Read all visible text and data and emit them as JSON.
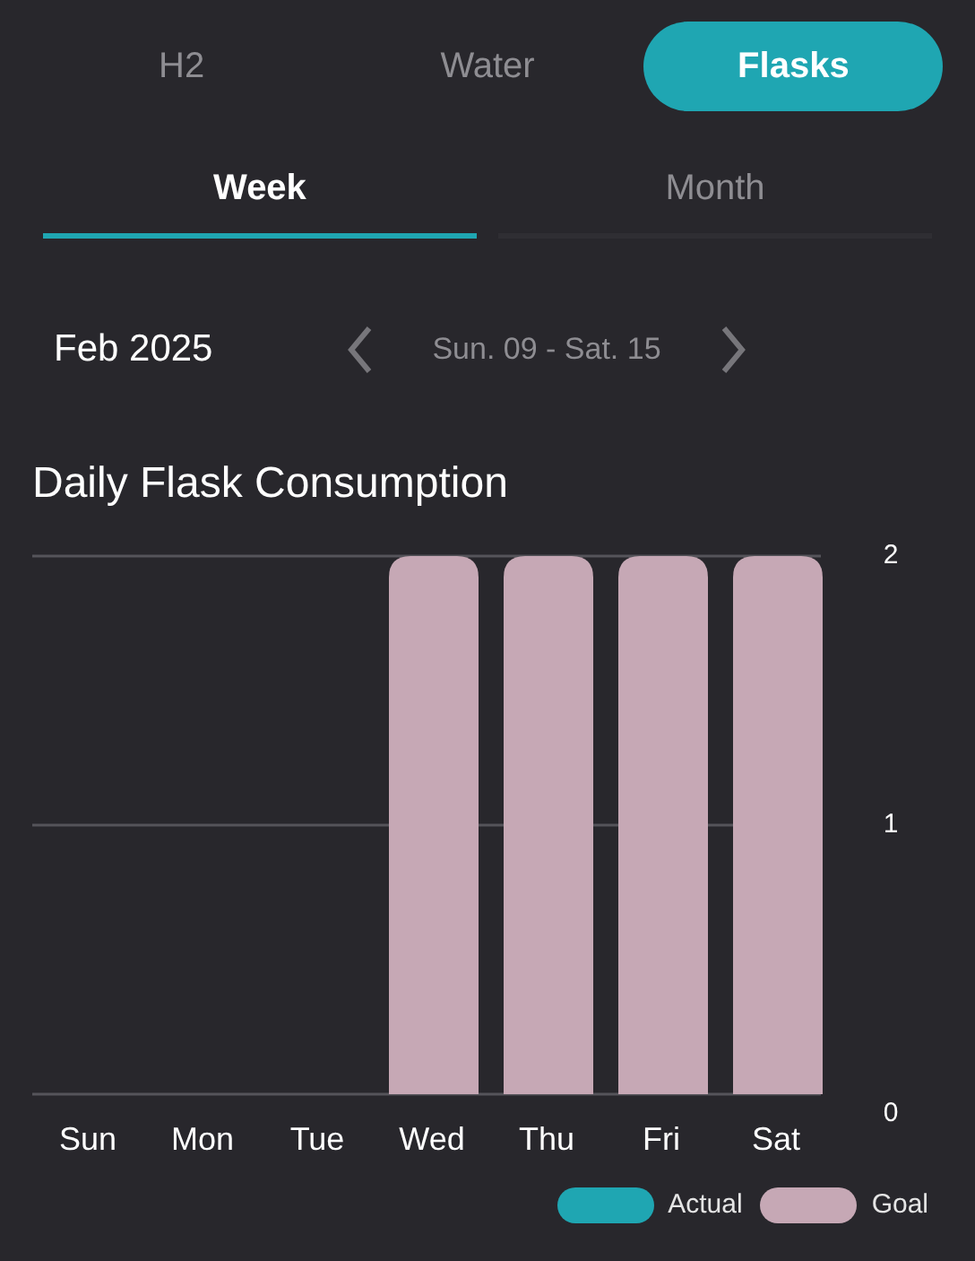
{
  "category_tabs": [
    {
      "label": "H2",
      "selected": false
    },
    {
      "label": "Water",
      "selected": false
    },
    {
      "label": "Flasks",
      "selected": true
    }
  ],
  "period_tabs": [
    {
      "label": "Week",
      "selected": true
    },
    {
      "label": "Month",
      "selected": false
    }
  ],
  "month": "Feb 2025",
  "date_range": "Sun. 09 - Sat. 15",
  "chart_title": "Daily Flask Consumption",
  "chart_data": {
    "type": "bar",
    "categories": [
      "Sun",
      "Mon",
      "Tue",
      "Wed",
      "Thu",
      "Fri",
      "Sat"
    ],
    "ylim": [
      0,
      2
    ],
    "yticks": [
      0,
      1,
      2
    ],
    "series": [
      {
        "name": "Actual",
        "color": "#1fa6b2",
        "values": [
          0,
          0,
          0,
          0,
          0,
          0,
          0
        ]
      },
      {
        "name": "Goal",
        "color": "#c6a8b5",
        "values": [
          0,
          0,
          0,
          2,
          2,
          2,
          2
        ]
      }
    ]
  }
}
